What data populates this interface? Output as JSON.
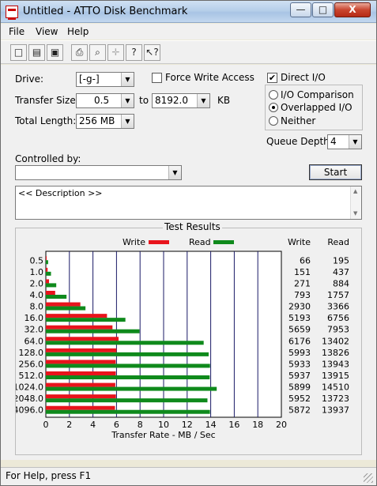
{
  "window": {
    "title": "Untitled - ATTO Disk Benchmark"
  },
  "title_buttons": {
    "minimize": "—",
    "maximize": "□",
    "close": "X"
  },
  "menu": {
    "items": [
      "File",
      "View",
      "Help"
    ]
  },
  "toolbar": {
    "icons": [
      "new-icon",
      "open-icon",
      "save-icon",
      "print-icon",
      "print-preview-icon",
      "move-icon",
      "help-icon",
      "context-help-icon"
    ],
    "glyphs": [
      "□",
      "▤",
      "▣",
      "⎙",
      "⌕",
      "✛",
      "?",
      "↖?"
    ]
  },
  "form": {
    "drive_label": "Drive:",
    "drive_value": "[-g-]",
    "transfer_size_label": "Transfer Size:",
    "transfer_from": "0.5",
    "to_label": "to",
    "transfer_to": "8192.0",
    "kb_label": "KB",
    "total_length_label": "Total Length:",
    "total_length": "256 MB",
    "force_write_label": "Force Write Access",
    "force_write_checked": false,
    "direct_io_label": "Direct I/O",
    "direct_io_checked": true,
    "direct_io_check": "✔",
    "io_comparison_label": "I/O Comparison",
    "overlapped_io_label": "Overlapped I/O",
    "neither_label": "Neither",
    "selected_io_mode": "Overlapped I/O",
    "queue_depth_label": "Queue Depth:",
    "queue_depth": "4",
    "controlled_by_label": "Controlled by:",
    "controlled_by_value": "",
    "start_button": "Start",
    "description": "<< Description >>",
    "dropdown_arrow": "▼",
    "scroll_up": "▲",
    "scroll_down": "▼"
  },
  "results": {
    "title": "Test Results"
  },
  "chart_data": {
    "type": "bar",
    "orientation": "horizontal",
    "categories": [
      "0.5",
      "1.0",
      "2.0",
      "4.0",
      "8.0",
      "16.0",
      "32.0",
      "64.0",
      "128.0",
      "256.0",
      "512.0",
      "1024.0",
      "2048.0",
      "4096.0"
    ],
    "series": [
      {
        "name": "Write",
        "color": "#e8141c",
        "values": [
          66,
          151,
          271,
          793,
          2930,
          5193,
          5659,
          6176,
          5993,
          5933,
          5937,
          5899,
          5952,
          5872
        ]
      },
      {
        "name": "Read",
        "color": "#0f8a1c",
        "values": [
          195,
          437,
          884,
          1757,
          3366,
          6756,
          7953,
          13402,
          13826,
          13943,
          13915,
          14510,
          13723,
          13937
        ]
      }
    ],
    "xlabel": "Transfer Rate - MB / Sec",
    "xlim": [
      0,
      20
    ],
    "xticks": [
      "0",
      "2",
      "4",
      "6",
      "8",
      "10",
      "12",
      "14",
      "16",
      "18",
      "20"
    ],
    "value_unit_divisor": 1000,
    "table_headers": [
      "Write",
      "Read"
    ],
    "grid": true,
    "legend": "top"
  },
  "status": {
    "text": "For Help, press F1"
  }
}
